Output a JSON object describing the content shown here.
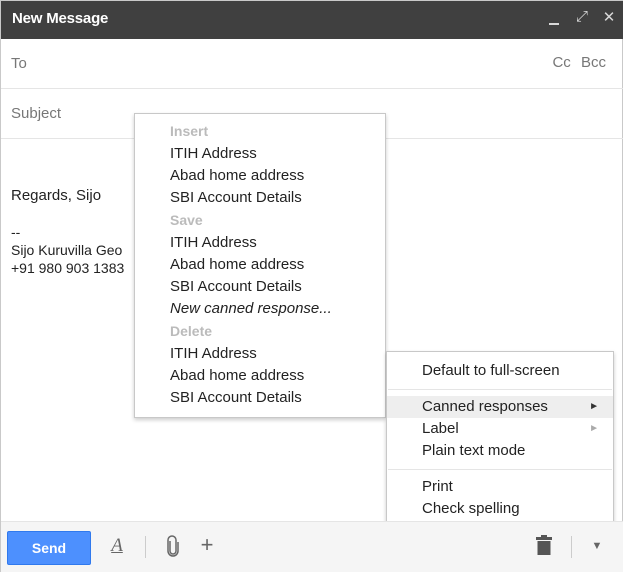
{
  "window": {
    "title": "New Message",
    "minimize_icon": "minimize-icon",
    "expand_icon": "expand-icon",
    "close_icon": "close-icon",
    "expand_glyph": "⤢",
    "close_glyph": "✕"
  },
  "fields": {
    "to_label": "To",
    "cc_label": "Cc",
    "bcc_label": "Bcc",
    "subject_label": "Subject"
  },
  "body": {
    "regards": "Regards, Sijo",
    "dash": "--",
    "sig_name": "Sijo Kuruvilla Geo",
    "sig_phone": "+91 980 903 1383"
  },
  "canned_menu": {
    "insert_header": "Insert",
    "insert_items": [
      "ITIH Address",
      "Abad home address",
      "SBI Account Details"
    ],
    "save_header": "Save",
    "save_items": [
      "ITIH Address",
      "Abad home address",
      "SBI Account Details"
    ],
    "new_canned": "New canned response...",
    "delete_header": "Delete",
    "delete_items": [
      "ITIH Address",
      "Abad home address",
      "SBI Account Details"
    ]
  },
  "more_menu": {
    "full_screen": "Default to full-screen",
    "canned_responses": "Canned responses",
    "label": "Label",
    "plain_text": "Plain text mode",
    "print": "Print",
    "check_spelling": "Check spelling",
    "submenu_arrow": "►"
  },
  "toolbar": {
    "send_label": "Send",
    "format_glyph": "A",
    "attach_glyph": "📎",
    "plus_glyph": "+",
    "trash_glyph": "🗑",
    "more_glyph": "▼"
  }
}
